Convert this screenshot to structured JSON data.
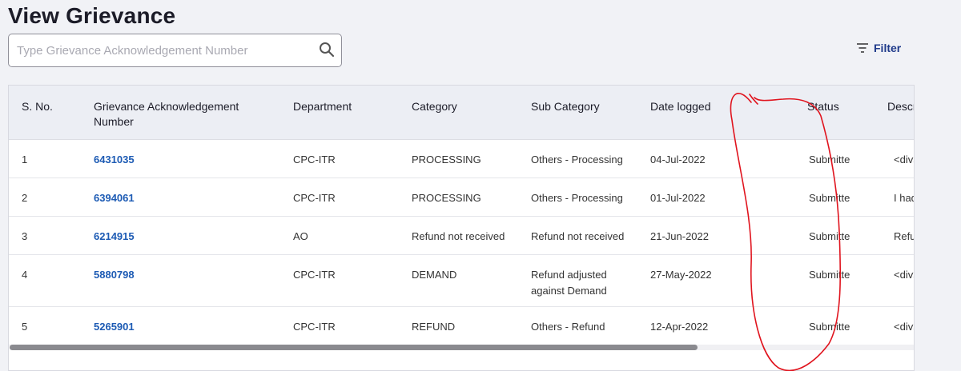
{
  "page": {
    "title": "View Grievance"
  },
  "search": {
    "placeholder": "Type Grievance Acknowledgement Number",
    "value": ""
  },
  "filter": {
    "label": "Filter"
  },
  "table": {
    "columns": [
      "S. No.",
      "Grievance Acknowledgement Number",
      "Department",
      "Category",
      "Sub Category",
      "Date logged",
      "Status",
      "Description"
    ],
    "rows": [
      {
        "sno": "1",
        "ack": "6431035",
        "dept": "CPC-ITR",
        "category": "PROCESSING",
        "subcat": "Others - Processing",
        "date": "04-Jul-2022",
        "status": "Submitted",
        "desc": "<div>Process"
      },
      {
        "sno": "2",
        "ack": "6394061",
        "dept": "CPC-ITR",
        "category": "PROCESSING",
        "subcat": "Others - Processing",
        "date": "01-Jul-2022",
        "status": "Submitted",
        "desc": "I had filed my"
      },
      {
        "sno": "3",
        "ack": "6214915",
        "dept": "AO",
        "category": "Refund not received",
        "subcat": "Refund not received",
        "date": "21-Jun-2022",
        "status": "Submitted",
        "desc": "Refund is kep"
      },
      {
        "sno": "4",
        "ack": "5880798",
        "dept": "CPC-ITR",
        "category": "DEMAND",
        "subcat": "Refund adjusted against Demand",
        "date": "27-May-2022",
        "status": "Submitted",
        "desc": "<div>Refund"
      },
      {
        "sno": "5",
        "ack": "5265901",
        "dept": "CPC-ITR",
        "category": "REFUND",
        "subcat": "Others - Refund",
        "date": "12-Apr-2022",
        "status": "Submitted",
        "desc": "<div>I filed m"
      }
    ]
  },
  "scrollbar": {
    "visible_fraction": 0.76
  },
  "colors": {
    "link": "#1d5bb4",
    "filter": "#1f3a8a",
    "header_bg": "#eceef4",
    "annotation": "#e0141e"
  },
  "icons": {
    "search": "search-icon",
    "filter": "filter-icon"
  }
}
